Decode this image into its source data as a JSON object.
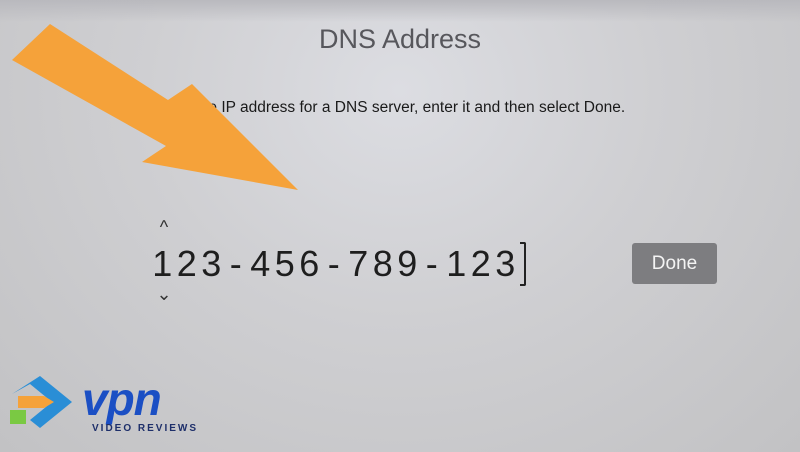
{
  "screen": {
    "title": "DNS Address",
    "instruction": "ve the IP address for a DNS server, enter it and then select Done."
  },
  "entry": {
    "characters": [
      "1",
      "2",
      "3",
      "-",
      "4",
      "5",
      "6",
      "-",
      "7",
      "8",
      "9",
      "-",
      "1",
      "2",
      "3"
    ],
    "caret_up": "^",
    "caret_down": "ˇ"
  },
  "done_button": {
    "label": "Done"
  },
  "watermark": {
    "brand": "vpn",
    "tagline": "VIDEO REVIEWS"
  },
  "colors": {
    "arrow": "#f5a23a",
    "button": "#7d7d80",
    "logo_blue": "#1b4fc4"
  }
}
